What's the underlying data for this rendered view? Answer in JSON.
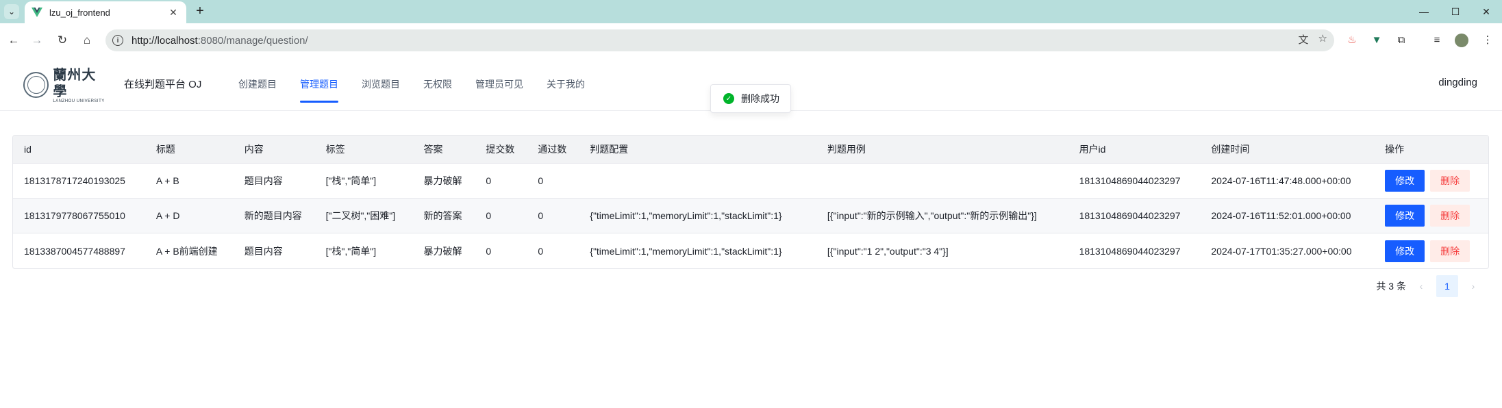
{
  "browser": {
    "tab_title": "lzu_oj_frontend",
    "url_host": "http://localhost",
    "url_path": ":8080/manage/question/"
  },
  "app": {
    "logo_cn": "蘭州大學",
    "logo_en": "LANZHOU UNIVERSITY",
    "site_title": "在线判题平台 OJ",
    "menu": [
      "创建题目",
      "管理题目",
      "浏览题目",
      "无权限",
      "管理员可见",
      "关于我的"
    ],
    "active_menu_index": 1,
    "username": "dingding"
  },
  "toast": {
    "text": "删除成功",
    "status_color": "#00b42a"
  },
  "table": {
    "columns": [
      "id",
      "标题",
      "内容",
      "标签",
      "答案",
      "提交数",
      "通过数",
      "判题配置",
      "判题用例",
      "用户id",
      "创建时间",
      "操作"
    ],
    "rows": [
      [
        "1813178717240193025",
        "A + B",
        "题目内容",
        "[\"栈\",\"简单\"]",
        "暴力破解",
        "0",
        "0",
        "",
        "",
        "1813104869044023297",
        "2024-07-16T11:47:48.000+00:00"
      ],
      [
        "1813179778067755010",
        "A + D",
        "新的题目内容",
        "[\"二叉树\",\"困难\"]",
        "新的答案",
        "0",
        "0",
        "{\"timeLimit\":1,\"memoryLimit\":1,\"stackLimit\":1}",
        "[{\"input\":\"新的示例输入\",\"output\":\"新的示例输出\"}]",
        "1813104869044023297",
        "2024-07-16T11:52:01.000+00:00"
      ],
      [
        "1813387004577488897",
        "A + B前端创建",
        "题目内容",
        "[\"栈\",\"简单\"]",
        "暴力破解",
        "0",
        "0",
        "{\"timeLimit\":1,\"memoryLimit\":1,\"stackLimit\":1}",
        "[{\"input\":\"1 2\",\"output\":\"3 4\"}]",
        "1813104869044023297",
        "2024-07-17T01:35:27.000+00:00"
      ]
    ],
    "edit_label": "修改",
    "delete_label": "删除"
  },
  "pagination": {
    "total_text": "共 3 条",
    "current_page": "1"
  },
  "colors": {
    "primary": "#165dff",
    "danger": "#f53f3f",
    "danger_bg": "#ffece8",
    "browser_frame": "#b7dedc"
  }
}
